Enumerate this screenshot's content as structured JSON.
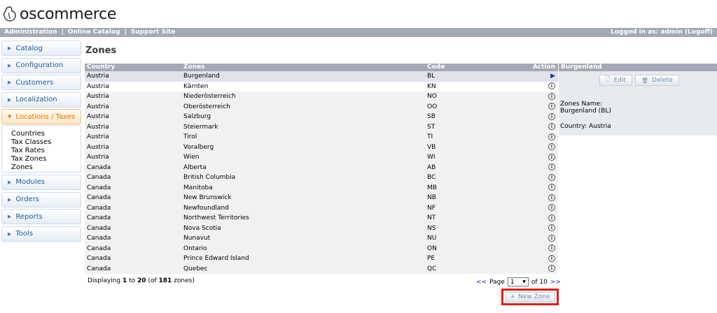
{
  "logo": {
    "text": "oscommerce"
  },
  "topbar": {
    "links": [
      "Administration",
      "Online Catalog",
      "Support Site"
    ],
    "separator": "|",
    "login_status": "Logged in as: admin (Logoff)"
  },
  "sidebar": {
    "items": [
      {
        "label": "Catalog"
      },
      {
        "label": "Configuration"
      },
      {
        "label": "Customers"
      },
      {
        "label": "Localization"
      },
      {
        "label": "Locations / Taxes"
      },
      {
        "label": "Modules"
      },
      {
        "label": "Orders"
      },
      {
        "label": "Reports"
      },
      {
        "label": "Tools"
      }
    ],
    "submenu": [
      "Countries",
      "Tax Classes",
      "Tax Rates",
      "Tax Zones",
      "Zones"
    ]
  },
  "page": {
    "title": "Zones"
  },
  "table": {
    "headers": {
      "country": "Country",
      "zones": "Zones",
      "code": "Code",
      "action": "Action"
    },
    "rows": [
      {
        "country": "Austria",
        "zone": "Burgenland",
        "code": "BL"
      },
      {
        "country": "Austria",
        "zone": "Kärnten",
        "code": "KN"
      },
      {
        "country": "Austria",
        "zone": "Niederösterreich",
        "code": "NO"
      },
      {
        "country": "Austria",
        "zone": "Oberösterreich",
        "code": "OO"
      },
      {
        "country": "Austria",
        "zone": "Salzburg",
        "code": "SB"
      },
      {
        "country": "Austria",
        "zone": "Steiermark",
        "code": "ST"
      },
      {
        "country": "Austria",
        "zone": "Tirol",
        "code": "TI"
      },
      {
        "country": "Austria",
        "zone": "Voralberg",
        "code": "VB"
      },
      {
        "country": "Austria",
        "zone": "Wien",
        "code": "WI"
      },
      {
        "country": "Canada",
        "zone": "Alberta",
        "code": "AB"
      },
      {
        "country": "Canada",
        "zone": "British Columbia",
        "code": "BC"
      },
      {
        "country": "Canada",
        "zone": "Manitoba",
        "code": "MB"
      },
      {
        "country": "Canada",
        "zone": "New Brunswick",
        "code": "NB"
      },
      {
        "country": "Canada",
        "zone": "Newfoundland",
        "code": "NF"
      },
      {
        "country": "Canada",
        "zone": "Northwest Territories",
        "code": "NT"
      },
      {
        "country": "Canada",
        "zone": "Nova Scotia",
        "code": "NS"
      },
      {
        "country": "Canada",
        "zone": "Nunavut",
        "code": "NU"
      },
      {
        "country": "Canada",
        "zone": "Ontario",
        "code": "ON"
      },
      {
        "country": "Canada",
        "zone": "Prince Edward Island",
        "code": "PE"
      },
      {
        "country": "Canada",
        "zone": "Quebec",
        "code": "QC"
      }
    ],
    "info_glyph": "i",
    "selected_glyph": "▶"
  },
  "footer": {
    "displaying_prefix": "Displaying",
    "from": "1",
    "to_word": "to",
    "to": "20",
    "of_prefix": "(of",
    "total": "181",
    "of_suffix": "zones)"
  },
  "pager": {
    "prev": "<<",
    "page_label": "Page",
    "page_value": "1",
    "of_label": "of 10",
    "next": ">>"
  },
  "new_zone": {
    "label": "New Zone",
    "icon": "+"
  },
  "info_panel": {
    "heading": "Burgenland",
    "edit_label": "Edit",
    "delete_label": "Delete",
    "zones_name_label": "Zones Name:",
    "zones_name_value": "Burgenland (BL)",
    "country_line": "Country: Austria"
  },
  "colors": {
    "header_bar": "#a3a9b6",
    "menu_link": "#1c5a99",
    "active_menu": "#e07b00",
    "highlight": "#e41b17"
  }
}
